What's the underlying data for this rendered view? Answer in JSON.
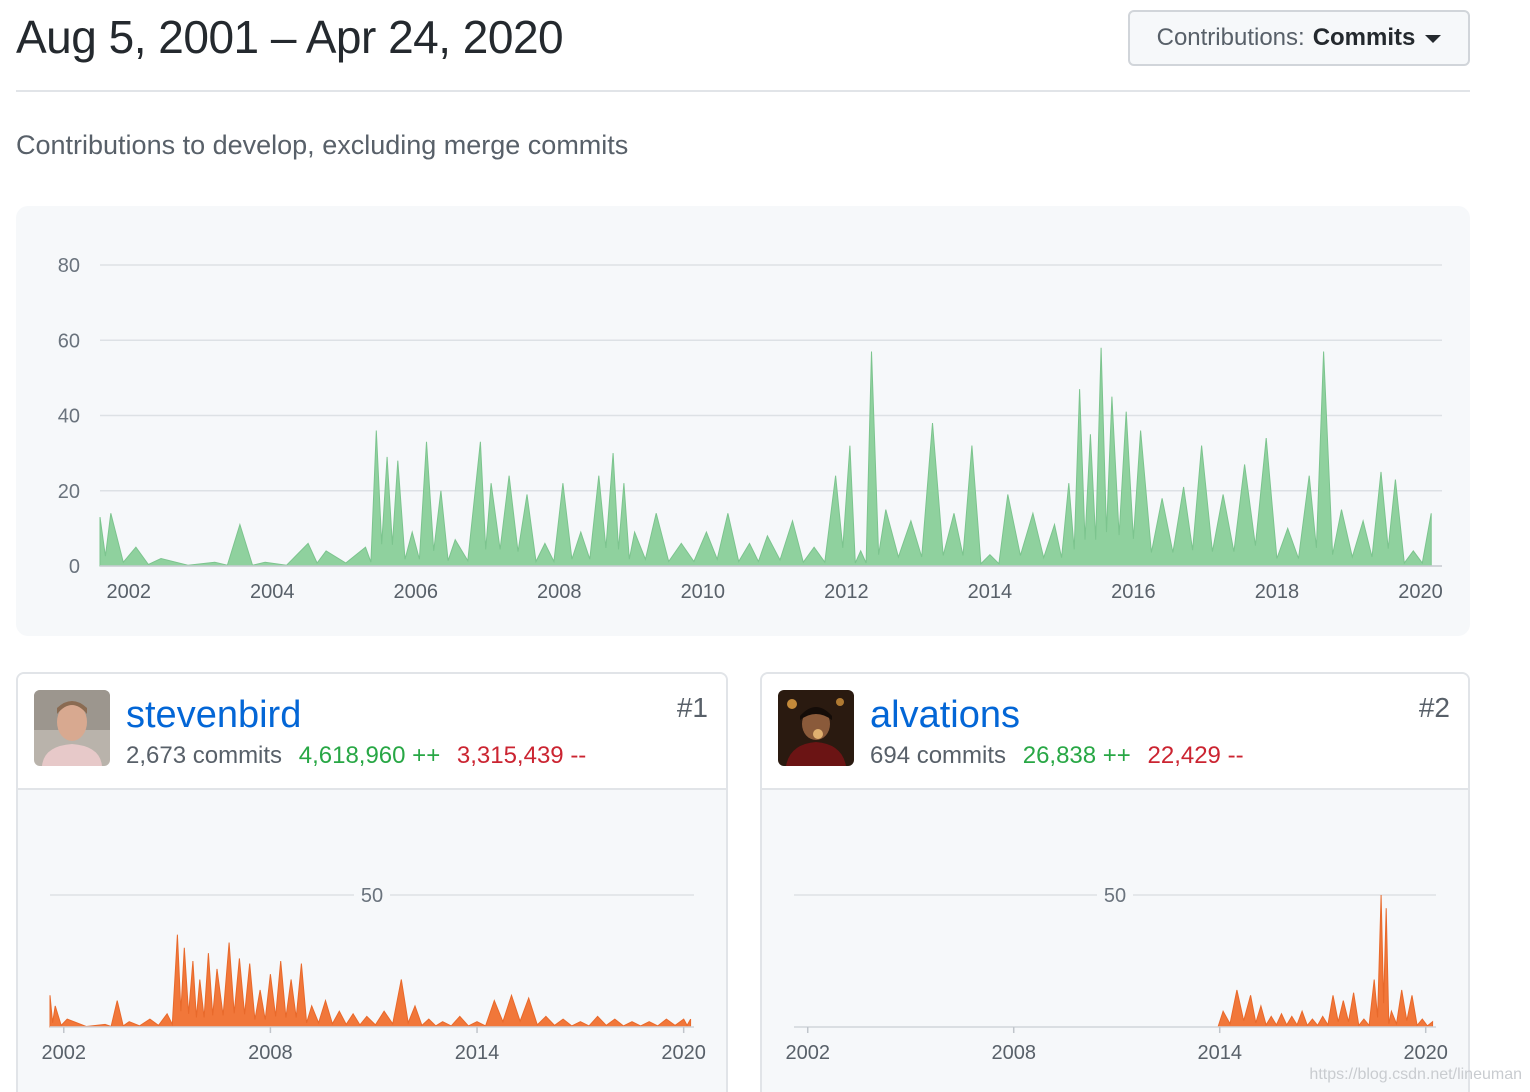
{
  "header": {
    "date_range": "Aug 5, 2001 – Apr 24, 2020",
    "dropdown_prefix": "Contributions:",
    "dropdown_value": "Commits"
  },
  "subtitle": "Contributions to develop, excluding merge commits",
  "colors": {
    "main_area": "#8fd19e",
    "contributor_area": "#f1773a",
    "grid": "#dde1e5",
    "link": "#0366d6",
    "additions": "#28a745",
    "deletions": "#cb2431"
  },
  "chart_data": [
    {
      "type": "area",
      "title": "",
      "xlabel": "",
      "ylabel": "",
      "xlim": [
        2001.6,
        2020.3
      ],
      "ylim": [
        0,
        80
      ],
      "yticks": [
        0,
        20,
        40,
        60,
        80
      ],
      "xticks": [
        2002,
        2004,
        2006,
        2008,
        2010,
        2012,
        2014,
        2016,
        2018,
        2020
      ],
      "grid": true,
      "series": [
        {
          "x": [
            2001.6,
            2001.75,
            2002.1,
            2002.45,
            2003.2,
            2003.55,
            2003.9,
            2004.5,
            2004.75,
            2005.3,
            2005.45,
            2005.6,
            2005.75,
            2005.95,
            2006.15,
            2006.35,
            2006.55,
            2006.9,
            2007.05,
            2007.3,
            2007.55,
            2007.8,
            2008.05,
            2008.3,
            2008.55,
            2008.75,
            2008.9,
            2009.05,
            2009.35,
            2009.7,
            2010.05,
            2010.35,
            2010.65,
            2010.9,
            2011.25,
            2011.55,
            2011.85,
            2012.05,
            2012.2,
            2012.35,
            2012.55,
            2012.9,
            2013.2,
            2013.5,
            2013.75,
            2014.0,
            2014.25,
            2014.6,
            2014.9,
            2015.1,
            2015.25,
            2015.4,
            2015.55,
            2015.7,
            2015.9,
            2016.1,
            2016.4,
            2016.7,
            2016.95,
            2017.25,
            2017.55,
            2017.85,
            2018.15,
            2018.45,
            2018.65,
            2018.9,
            2019.2,
            2019.45,
            2019.65,
            2019.9,
            2020.15
          ],
          "y": [
            13,
            14,
            5,
            2,
            1,
            11,
            1,
            6,
            4,
            5,
            36,
            29,
            28,
            9,
            33,
            20,
            7,
            33,
            22,
            24,
            19,
            6,
            22,
            9,
            24,
            30,
            22,
            9,
            14,
            6,
            9,
            14,
            6,
            8,
            12,
            5,
            24,
            32,
            4,
            57,
            15,
            12,
            38,
            14,
            32,
            3,
            19,
            14,
            11,
            22,
            47,
            35,
            58,
            45,
            41,
            36,
            18,
            21,
            32,
            19,
            27,
            34,
            10,
            24,
            57,
            15,
            12,
            25,
            23,
            4,
            14
          ]
        }
      ]
    },
    {
      "type": "area",
      "name_label": "stevenbird",
      "rank": "#1",
      "commits": "2,673 commits",
      "additions": "4,618,960 ++",
      "deletions": "3,315,439 --",
      "xlim": [
        2001.6,
        2020.3
      ],
      "ylim": [
        0,
        50
      ],
      "yticks": [
        50
      ],
      "xticks": [
        2002,
        2008,
        2014,
        2020
      ],
      "grid": true,
      "series": [
        {
          "x": [
            2001.6,
            2001.75,
            2002.1,
            2003.2,
            2003.55,
            2003.9,
            2004.5,
            2005.0,
            2005.3,
            2005.5,
            2005.75,
            2005.95,
            2006.2,
            2006.45,
            2006.8,
            2007.1,
            2007.4,
            2007.7,
            2008.0,
            2008.3,
            2008.6,
            2008.9,
            2009.2,
            2009.6,
            2010.0,
            2010.4,
            2010.8,
            2011.3,
            2011.8,
            2012.2,
            2012.6,
            2013.0,
            2013.5,
            2014.0,
            2014.5,
            2015.0,
            2015.5,
            2016.0,
            2016.5,
            2017.0,
            2017.5,
            2018.0,
            2018.5,
            2019.0,
            2019.5,
            2020.0,
            2020.2
          ],
          "y": [
            12,
            8,
            3,
            1,
            10,
            2,
            3,
            5,
            35,
            30,
            25,
            18,
            28,
            22,
            32,
            26,
            24,
            14,
            20,
            25,
            18,
            24,
            8,
            10,
            6,
            5,
            4,
            6,
            18,
            8,
            3,
            2,
            4,
            2,
            10,
            12,
            11,
            4,
            3,
            2,
            4,
            3,
            2,
            2,
            3,
            3,
            3
          ]
        }
      ]
    },
    {
      "type": "area",
      "name_label": "alvations",
      "rank": "#2",
      "commits": "694 commits",
      "additions": "26,838 ++",
      "deletions": "22,429 --",
      "xlim": [
        2001.6,
        2020.3
      ],
      "ylim": [
        0,
        50
      ],
      "yticks": [
        50
      ],
      "xticks": [
        2002,
        2008,
        2014,
        2020
      ],
      "grid": true,
      "series": [
        {
          "x": [
            2001.6,
            2013.8,
            2014.1,
            2014.5,
            2014.9,
            2015.2,
            2015.5,
            2015.8,
            2016.1,
            2016.4,
            2016.7,
            2017.0,
            2017.3,
            2017.6,
            2017.9,
            2018.2,
            2018.5,
            2018.7,
            2018.85,
            2019.0,
            2019.3,
            2019.6,
            2019.9,
            2020.2
          ],
          "y": [
            0,
            0,
            6,
            14,
            12,
            8,
            4,
            5,
            4,
            6,
            3,
            4,
            12,
            10,
            13,
            3,
            18,
            50,
            45,
            6,
            14,
            12,
            3,
            2
          ]
        }
      ]
    }
  ],
  "watermark": "https://blog.csdn.net/lineuman"
}
